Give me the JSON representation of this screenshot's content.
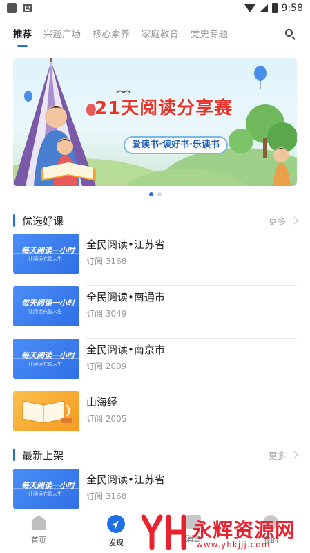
{
  "status_bar": {
    "time": "9:58"
  },
  "tabs": [
    {
      "label": "推荐",
      "active": true
    },
    {
      "label": "兴趣广场",
      "active": false
    },
    {
      "label": "核心素养",
      "active": false
    },
    {
      "label": "家庭教育",
      "active": false
    },
    {
      "label": "党史专题",
      "active": false
    }
  ],
  "banner": {
    "title": "21天阅读分享赛",
    "slogan": "爱读书·读好书·乐读书",
    "page_count": 2,
    "active_page": 1
  },
  "sections": {
    "featured": {
      "title": "优选好课",
      "more_label": "更多",
      "items": [
        {
          "thumb_title": "每天阅读一小时",
          "thumb_subtitle": "让阅读充盈人生",
          "name": "全民阅读•江苏省",
          "subs": "订阅 3168"
        },
        {
          "thumb_title": "每天阅读一小时",
          "thumb_subtitle": "让阅读充盈人生",
          "name": "全民阅读•南通市",
          "subs": "订阅 3049"
        },
        {
          "thumb_title": "每天阅读一小时",
          "thumb_subtitle": "让阅读充盈人生",
          "name": "全民阅读•南京市",
          "subs": "订阅 2009"
        },
        {
          "thumb_title": "",
          "thumb_subtitle": "",
          "name": "山海经",
          "subs": "订阅 2005"
        }
      ]
    },
    "new_arrivals": {
      "title": "最新上架",
      "more_label": "更多",
      "items": [
        {
          "thumb_title": "每天阅读一小时",
          "thumb_subtitle": "让阅读充盈人生",
          "name": "全民阅读•江苏省",
          "subs": "订阅 3168"
        }
      ]
    }
  },
  "bottom_nav": [
    {
      "label": "首页",
      "icon": "home-icon",
      "active": false
    },
    {
      "label": "发现",
      "icon": "compass-icon",
      "active": true
    },
    {
      "label": "消息",
      "icon": "message-icon",
      "active": false
    },
    {
      "label": "我的",
      "icon": "user-icon",
      "active": false
    }
  ],
  "watermark": {
    "text": "永辉资源网",
    "url": "www.yhkjjj.com"
  },
  "colors": {
    "accent": "#1f6fe5",
    "banner_title": "#e8332a",
    "watermark": "#e8232f"
  }
}
